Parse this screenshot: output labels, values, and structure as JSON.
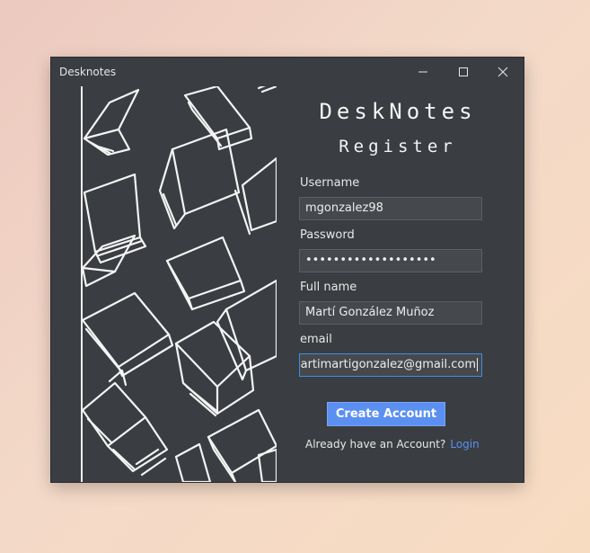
{
  "window": {
    "title": "Desknotes",
    "minimize_icon": "minimize-icon",
    "maximize_icon": "maximize-icon",
    "close_icon": "close-icon"
  },
  "app": {
    "name": "DeskNotes",
    "subtitle": "Register"
  },
  "form": {
    "username_label": "Username",
    "username_value": "mgonzalez98",
    "password_label": "Password",
    "password_value": "•••••••••••••••••••",
    "fullname_label": "Full name",
    "fullname_value": "Martí González Muñoz",
    "email_label": "email",
    "email_value": "martimartigonzalez@gmail.com",
    "submit_label": "Create Account"
  },
  "footer": {
    "prompt": "Already have an Account?",
    "login_link": "Login"
  },
  "colors": {
    "window_bg": "#3a3d41",
    "field_bg": "#45494d",
    "accent": "#5b8ff2",
    "focus_border": "#3d8fe0"
  }
}
